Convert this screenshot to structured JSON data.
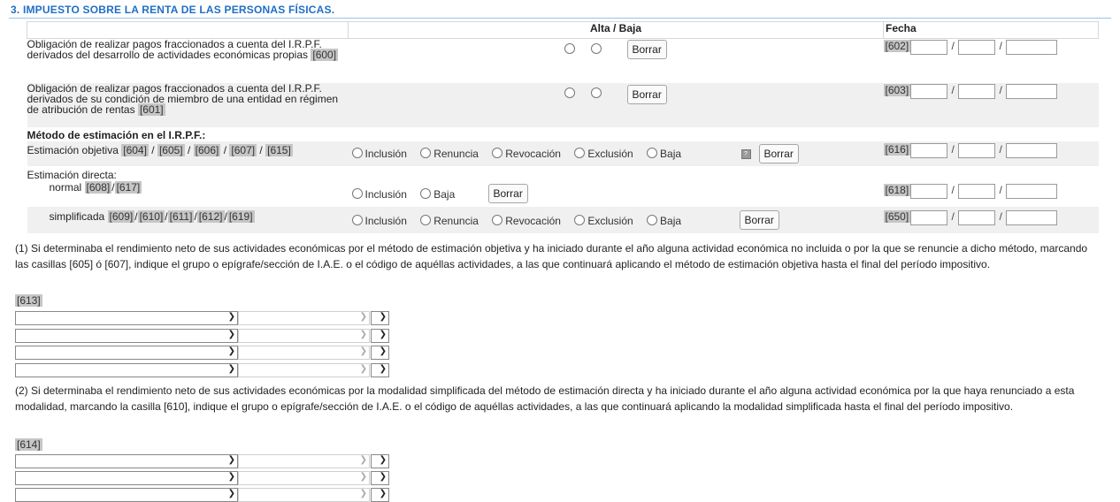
{
  "section": {
    "title": "3. IMPUESTO SOBRE LA RENTA DE LAS PERSONAS FÍSICAS."
  },
  "headers": {
    "alta_baja": "Alta / Baja",
    "fecha": "Fecha"
  },
  "rows": [
    {
      "label": "Obligación de realizar pagos fraccionados a cuenta del I.R.P.F. derivados del desarrollo de actividades económicas propias",
      "code": "[600]",
      "date_code": "[602]",
      "button": "Borrar"
    },
    {
      "label": "Obligación de realizar pagos fraccionados a cuenta del I.R.P.F. derivados de su condición de miembro de una entidad en régimen de atribución de rentas",
      "code": "[601]",
      "date_code": "[603]",
      "button": "Borrar"
    }
  ],
  "metodo": {
    "title": "Método de estimación en el I.R.P.F.:"
  },
  "objetiva": {
    "label": "Estimación objetiva",
    "codes": [
      "[604]",
      "[605]",
      "[606]",
      "[607]",
      "[615]"
    ],
    "options": [
      "Inclusión",
      "Renuncia",
      "Revocación",
      "Exclusión",
      "Baja"
    ],
    "button": "Borrar",
    "date_code": "[616]"
  },
  "directa": {
    "label": "Estimación directa:"
  },
  "normal": {
    "label": "normal",
    "codes": [
      "[608]",
      "[617]"
    ],
    "options": [
      "Inclusión",
      "Baja"
    ],
    "button": "Borrar",
    "date_code": "[618]"
  },
  "simplificada": {
    "label": "simplificada",
    "codes": [
      "[609]",
      "[610]",
      "[611]",
      "[612]",
      "[619]"
    ],
    "options": [
      "Inclusión",
      "Renuncia",
      "Revocación",
      "Exclusión",
      "Baja"
    ],
    "button": "Borrar",
    "date_code": "[650]"
  },
  "date_sep": "/",
  "note1": {
    "text": "(1) Si determinaba el rendimiento neto de sus actividades económicas por el método de estimación objetiva y ha iniciado durante el año alguna actividad económica no incluida o por la que se renuncie a dicho método, marcando las casillas [605] ó [607], indique el grupo o epígrafe/sección de I.A.E. o el código de aquéllas actividades, a las que continuará aplicando el método de estimación objetiva hasta el final del período impositivo.",
    "code": "[613]"
  },
  "note2": {
    "text": "(2) Si determinaba el rendimiento neto de sus actividades económicas por la modalidad simplificada del método de estimación directa y ha iniciado durante el año alguna actividad económica por la que haya renunciado a esta modalidad, marcando la casilla [610], indique el grupo o epígrafe/sección de I.A.E. o el código de aquéllas actividades, a las que continuará aplicando la modalidad simplificada hasta el final del período impositivo.",
    "code": "[614]"
  },
  "colors": {
    "title": "#1f6fc5",
    "code_bg": "#c6c6c6",
    "shade": "#f0f0f0"
  }
}
